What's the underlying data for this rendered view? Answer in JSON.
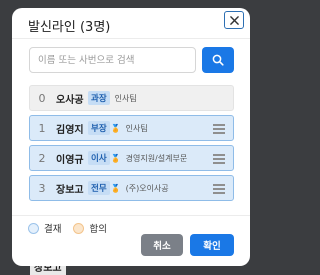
{
  "background": {
    "peek_text": "장보고"
  },
  "dialog": {
    "title": "발신라인 (3명)",
    "search": {
      "placeholder": "이름 또는 사번으로 검색",
      "value": ""
    },
    "lines": [
      {
        "order": "0",
        "name": "오사공",
        "rank": "과장",
        "dept": "인사팀",
        "state": "fixed"
      },
      {
        "order": "1",
        "name": "김영지",
        "rank": "부장",
        "dept": "인사팀",
        "state": "selected"
      },
      {
        "order": "2",
        "name": "이영규",
        "rank": "이사",
        "dept": "경영지원/설계부문",
        "state": "selected"
      },
      {
        "order": "3",
        "name": "장보고",
        "rank": "전무",
        "dept": "(주)오이사공",
        "state": "selected"
      }
    ],
    "legend": {
      "approve_label": "결재",
      "agree_label": "합의"
    },
    "buttons": {
      "cancel": "취소",
      "confirm": "확인"
    }
  },
  "colors": {
    "accent": "#1a78e6",
    "selected_bg": "#dbeaf9",
    "rank_bg": "#c6ddf5",
    "cancel_bg": "#7b8088"
  },
  "icons": {
    "close": "close-icon",
    "search": "search-icon",
    "drag": "drag-handle-icon",
    "medal": "medal-icon"
  }
}
